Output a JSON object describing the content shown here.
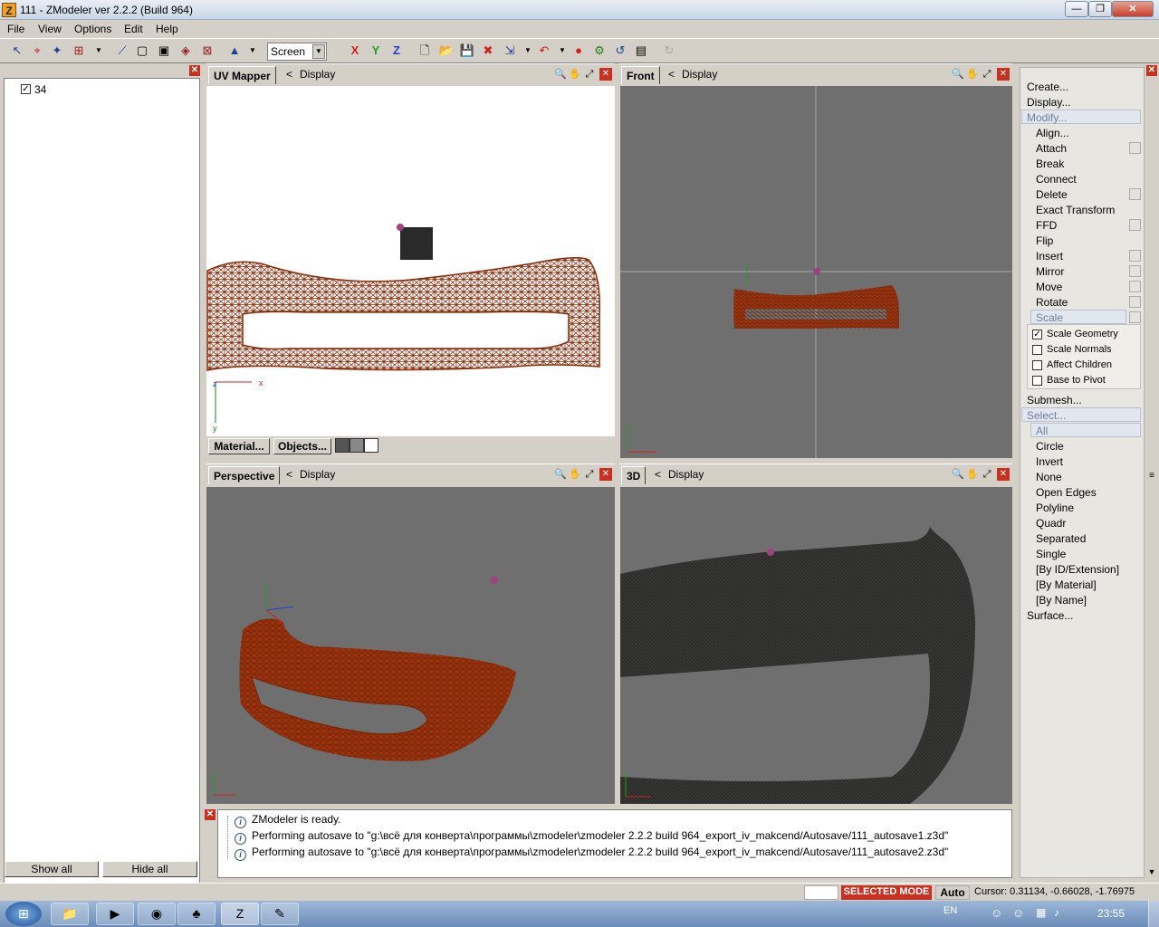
{
  "window": {
    "title": "111 - ZModeler ver 2.2.2 (Build 964)",
    "app_icon": "Z",
    "minimize": "—",
    "maximize": "❐",
    "close": "✕"
  },
  "menu": [
    "File",
    "View",
    "Options",
    "Edit",
    "Help"
  ],
  "toolbar": {
    "screen_select": "Screen",
    "axis_x": "X",
    "axis_y": "Y",
    "axis_z": "Z"
  },
  "left_panel": {
    "tree_item": "34",
    "show_all": "Show all",
    "hide_all": "Hide all"
  },
  "viewports": {
    "uv": {
      "tab": "UV Mapper",
      "display": "Display",
      "material_btn": "Material...",
      "objects_btn": "Objects...",
      "axis_x": "x",
      "axis_y": "y",
      "axis_z": "z"
    },
    "front": {
      "tab": "Front",
      "display": "Display"
    },
    "perspective": {
      "tab": "Perspective",
      "display": "Display"
    },
    "three_d": {
      "tab": "3D",
      "display": "Display"
    },
    "back_arrow": "<"
  },
  "right_panel": {
    "items": [
      "Create...",
      "Display...",
      "Modify..."
    ],
    "modify_items": [
      "Align...",
      "Attach",
      "Break",
      "Connect",
      "Delete",
      "Exact Transform",
      "FFD",
      "Flip",
      "Insert",
      "Mirror",
      "Move",
      "Rotate",
      "Scale"
    ],
    "scale_options": [
      {
        "label": "Scale Geometry",
        "checked": true
      },
      {
        "label": "Scale Normals",
        "checked": false
      },
      {
        "label": "Affect Children",
        "checked": false
      },
      {
        "label": "Base to Pivot",
        "checked": false
      }
    ],
    "submesh": "Submesh...",
    "select": "Select...",
    "select_items": [
      "All",
      "Circle",
      "Invert",
      "None",
      "Open Edges",
      "Polyline",
      "Quadr",
      "Separated",
      "Single",
      "[By ID/Extension]",
      "[By Material]",
      "[By Name]"
    ],
    "surface": "Surface..."
  },
  "log": [
    "ZModeler is ready.",
    "Performing autosave to \"g:\\всё для конверта\\программы\\zmodeler\\zmodeler 2.2.2 build 964_export_iv_makcend/Autosave/111_autosave1.z3d\"",
    "Performing autosave to \"g:\\всё для конверта\\программы\\zmodeler\\zmodeler 2.2.2 build 964_export_iv_makcend/Autosave/111_autosave2.z3d\""
  ],
  "status": {
    "mode": "SELECTED MODE",
    "auto": "Auto",
    "cursor": "Cursor: 0.31134, -0.66028, -1.76975"
  },
  "taskbar": {
    "lang": "EN",
    "time": "23:55"
  },
  "colors": {
    "wire": "#8a2a08",
    "viewport_gray": "#6f6f6f",
    "selected_mode": "#c83020"
  }
}
